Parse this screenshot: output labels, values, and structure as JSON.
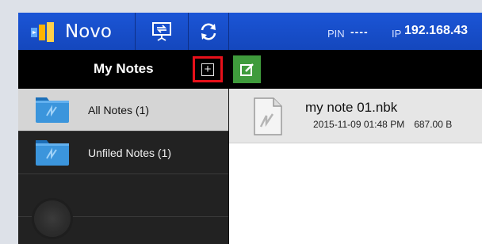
{
  "app": {
    "name": "Novo"
  },
  "topbar": {
    "pin_label": "PIN",
    "pin_value": "----",
    "ip_label": "IP",
    "ip_value": "192.168.43"
  },
  "sidebar": {
    "title": "My Notes",
    "items": [
      {
        "label": "All Notes (1)",
        "selected": true
      },
      {
        "label": "Unfiled Notes (1)",
        "selected": false
      }
    ]
  },
  "notes": [
    {
      "name": "my note 01.nbk",
      "date": "2015-11-09 01:48 PM",
      "size": "687.00 B"
    }
  ],
  "colors": {
    "topbar": "#1b55d6",
    "sidebar": "#222222",
    "selected_item": "#d5d5d5",
    "edit_button": "#3f9b3c",
    "highlight_outline": "#e8101a"
  },
  "icons": {
    "logo": "novo-logo-icon",
    "screen": "screen-share-icon",
    "refresh": "refresh-icon",
    "add": "add-note-icon",
    "edit": "edit-icon",
    "folder": "folder-icon",
    "note": "note-file-icon"
  }
}
